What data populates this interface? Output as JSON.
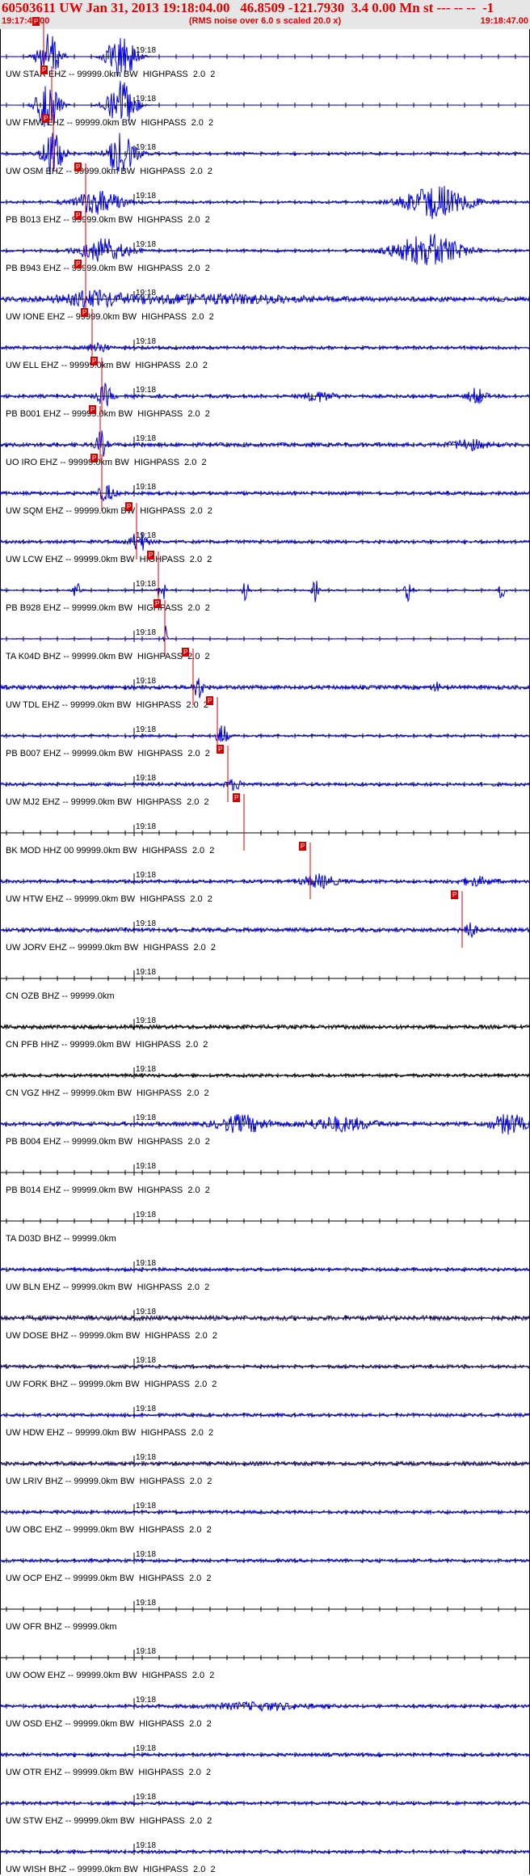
{
  "header": {
    "title": "60503611 UW Jan 31, 2013 19:18:04.00   46.8509 -121.7930  3.4 0.00 Mn st --- -- --  -1",
    "start_time": "19:17:44.00",
    "end_time": "19:18:47.00",
    "rms_note": "(RMS noise over 6.0 s scaled 20.0 x)"
  },
  "tick_label": "19:18",
  "pick_label": "P",
  "colors": {
    "header_text": "#e00000",
    "trace_blue": "#0000dd",
    "trace_black": "#000000",
    "pick": "#d40000",
    "header_bg": "#e6e6e6"
  },
  "traces": [
    {
      "label": "UW STAR EHZ -- 99999.0km BW  HIGHPASS  2.0  2",
      "amp": 0.1,
      "color": "blue",
      "bursts": [
        [
          60,
          14,
          34
        ],
        [
          150,
          18,
          30
        ]
      ],
      "pick": 40
    },
    {
      "label": "UW FMW EHZ -- 99999.0km BW  HIGHPASS  2.0  2",
      "amp": 0.1,
      "color": "blue",
      "bursts": [
        [
          60,
          14,
          34
        ],
        [
          150,
          18,
          30
        ]
      ],
      "pick": 50
    },
    {
      "label": "UW OSM EHZ -- 99999.0km BW  HIGHPASS  2.0  2",
      "amp": 1.5,
      "color": "blue",
      "bursts": [
        [
          65,
          14,
          26
        ],
        [
          150,
          18,
          26
        ]
      ],
      "pick": 52
    },
    {
      "label": "PB B013 EHZ -- 99999.0km BW  HIGHPASS  2.0  2",
      "amp": 1.5,
      "color": "blue",
      "bursts": [
        [
          120,
          30,
          14
        ],
        [
          540,
          40,
          20
        ]
      ],
      "pick": 92
    },
    {
      "label": "PB B943 EHZ -- 99999.0km BW  HIGHPASS  2.0  2",
      "amp": 1.5,
      "color": "blue",
      "bursts": [
        [
          130,
          30,
          14
        ],
        [
          530,
          40,
          20
        ]
      ],
      "pick": 92
    },
    {
      "label": "UW IONE EHZ -- 99999.0km BW  HIGHPASS  2.0  2",
      "amp": 3,
      "color": "blue",
      "bursts": [
        [
          115,
          40,
          8
        ],
        [
          260,
          120,
          4
        ]
      ],
      "pick": 92
    },
    {
      "label": "UW ELL EHZ -- 99999.0km BW  HIGHPASS  2.0  2",
      "amp": 2,
      "color": "blue",
      "bursts": [
        [
          120,
          10,
          8
        ]
      ],
      "pick": 100
    },
    {
      "label": "PB B001 EHZ -- 99999.0km BW  HIGHPASS  2.0  2",
      "amp": 2,
      "color": "blue",
      "bursts": [
        [
          130,
          8,
          14
        ],
        [
          395,
          18,
          6
        ],
        [
          590,
          10,
          10
        ]
      ],
      "pick": 112
    },
    {
      "label": "UO IRO EHZ -- 99999.0km BW  HIGHPASS  2.0  2",
      "amp": 2.5,
      "color": "blue",
      "bursts": [
        [
          125,
          6,
          16
        ],
        [
          580,
          20,
          6
        ]
      ],
      "pick": 110
    },
    {
      "label": "UW SQM EHZ -- 99999.0km BW  HIGHPASS  2.0  2",
      "amp": 2,
      "color": "blue",
      "bursts": [
        [
          132,
          10,
          10
        ]
      ],
      "pick": 112
    },
    {
      "label": "UW LCW EHZ -- 99999.0km BW  HIGHPASS  2.0  2",
      "amp": 2,
      "color": "blue",
      "bursts": [
        [
          172,
          10,
          12
        ]
      ],
      "pick": 155
    },
    {
      "label": "PB B928 EHZ -- 99999.0km BW  HIGHPASS  2.0  2",
      "amp": 1,
      "color": "blue",
      "bursts": [
        [
          95,
          4,
          16
        ],
        [
          200,
          4,
          18
        ],
        [
          305,
          4,
          16
        ],
        [
          390,
          4,
          14
        ],
        [
          505,
          4,
          14
        ],
        [
          620,
          4,
          12
        ]
      ],
      "pick": 182
    },
    {
      "label": "TA K04D BHZ -- 99999.0km BW  HIGHPASS  2.0  2",
      "amp": 0.5,
      "color": "blue",
      "bursts": [
        [
          205,
          2,
          16
        ]
      ],
      "pick": 190
    },
    {
      "label": "UW TDL EHZ -- 99999.0km BW  HIGHPASS  2.0  2",
      "amp": 2.5,
      "color": "blue",
      "bursts": [
        [
          245,
          6,
          14
        ],
        [
          540,
          4,
          6
        ]
      ],
      "pick": 225
    },
    {
      "label": "PB B007 EHZ -- 99999.0km BW  HIGHPASS  2.0  2",
      "amp": 1.5,
      "color": "blue",
      "bursts": [
        [
          275,
          6,
          16
        ]
      ],
      "pick": 255
    },
    {
      "label": "UW MJ2 EHZ -- 99999.0km BW  HIGHPASS  2.0  2",
      "amp": 2,
      "color": "blue",
      "bursts": [
        [
          290,
          10,
          6
        ]
      ],
      "pick": 268
    },
    {
      "label": "BK MOD HHZ 00 99999.0km BW  HIGHPASS  2.0  2",
      "amp": 0,
      "color": "blue",
      "bursts": [],
      "pick": 288
    },
    {
      "label": "UW HTW EHZ -- 99999.0km BW  HIGHPASS  2.0  2",
      "amp": 2,
      "color": "blue",
      "bursts": [
        [
          395,
          20,
          8
        ],
        [
          590,
          20,
          5
        ]
      ],
      "pick": 370
    },
    {
      "label": "UW JORV EHZ -- 99999.0km BW  HIGHPASS  2.0  2",
      "amp": 2.5,
      "color": "blue",
      "bursts": [
        [
          580,
          8,
          10
        ]
      ],
      "pick": 558
    },
    {
      "label": "CN OZB BHZ -- 99999.0km",
      "amp": 0,
      "color": "blue",
      "bursts": [],
      "pick": null
    },
    {
      "label": "CN PFB HHZ -- 99999.0km BW  HIGHPASS  2.0  2",
      "amp": 2.5,
      "color": "black",
      "bursts": [],
      "pick": null
    },
    {
      "label": "CN VGZ HHZ -- 99999.0km BW  HIGHPASS  2.0  2",
      "amp": 2,
      "color": "black",
      "bursts": [],
      "pick": null
    },
    {
      "label": "PB B004 EHZ -- 99999.0km BW  HIGHPASS  2.0  2",
      "amp": 2.5,
      "color": "blue",
      "bursts": [
        [
          300,
          30,
          10
        ],
        [
          420,
          40,
          8
        ],
        [
          630,
          20,
          12
        ]
      ],
      "pick": null
    },
    {
      "label": "PB B014 EHZ -- 99999.0km BW  HIGHPASS  2.0  2",
      "amp": 0,
      "color": "blue",
      "bursts": [],
      "pick": null
    },
    {
      "label": "TA D03D BHZ -- 99999.0km",
      "amp": 0,
      "color": "blue",
      "bursts": [],
      "pick": null
    },
    {
      "label": "UW BLN EHZ -- 99999.0km BW  HIGHPASS  2.0  2",
      "amp": 2,
      "color": "blue",
      "bursts": [],
      "pick": null
    },
    {
      "label": "UW DOSE BHZ -- 99999.0km BW  HIGHPASS  2.0  2",
      "amp": 3,
      "color": "navy",
      "bursts": [],
      "pick": null
    },
    {
      "label": "UW FORK BHZ -- 99999.0km BW  HIGHPASS  2.0  2",
      "amp": 2,
      "color": "navy",
      "bursts": [],
      "pick": null
    },
    {
      "label": "UW HDW EHZ -- 99999.0km BW  HIGHPASS  2.0  2",
      "amp": 2,
      "color": "blue",
      "bursts": [],
      "pick": null
    },
    {
      "label": "UW LRIV BHZ -- 99999.0km BW  HIGHPASS  2.0  2",
      "amp": 2.5,
      "color": "navy",
      "bursts": [],
      "pick": null
    },
    {
      "label": "UW OBC EHZ -- 99999.0km BW  HIGHPASS  2.0  2",
      "amp": 2,
      "color": "blue",
      "bursts": [],
      "pick": null
    },
    {
      "label": "UW OCP EHZ -- 99999.0km BW  HIGHPASS  2.0  2",
      "amp": 2,
      "color": "blue",
      "bursts": [],
      "pick": null
    },
    {
      "label": "UW OFR BHZ -- 99999.0km",
      "amp": 0,
      "color": "blue",
      "bursts": [],
      "pick": null
    },
    {
      "label": "UW OOW EHZ -- 99999.0km BW  HIGHPASS  2.0  2",
      "amp": 0,
      "color": "blue",
      "bursts": [],
      "pick": null
    },
    {
      "label": "UW OSD EHZ -- 99999.0km BW  HIGHPASS  2.0  2",
      "amp": 2,
      "color": "blue",
      "bursts": [
        [
          320,
          60,
          4
        ]
      ],
      "pick": null
    },
    {
      "label": "UW OTR EHZ -- 99999.0km BW  HIGHPASS  2.0  2",
      "amp": 2,
      "color": "blue",
      "bursts": [],
      "pick": null
    },
    {
      "label": "UW STW EHZ -- 99999.0km BW  HIGHPASS  2.0  2",
      "amp": 2,
      "color": "blue",
      "bursts": [],
      "pick": null
    },
    {
      "label": "UW WISH BHZ -- 99999.0km BW  HIGHPASS  2.0  2",
      "amp": 2,
      "color": "blue",
      "bursts": [],
      "pick": null
    }
  ]
}
